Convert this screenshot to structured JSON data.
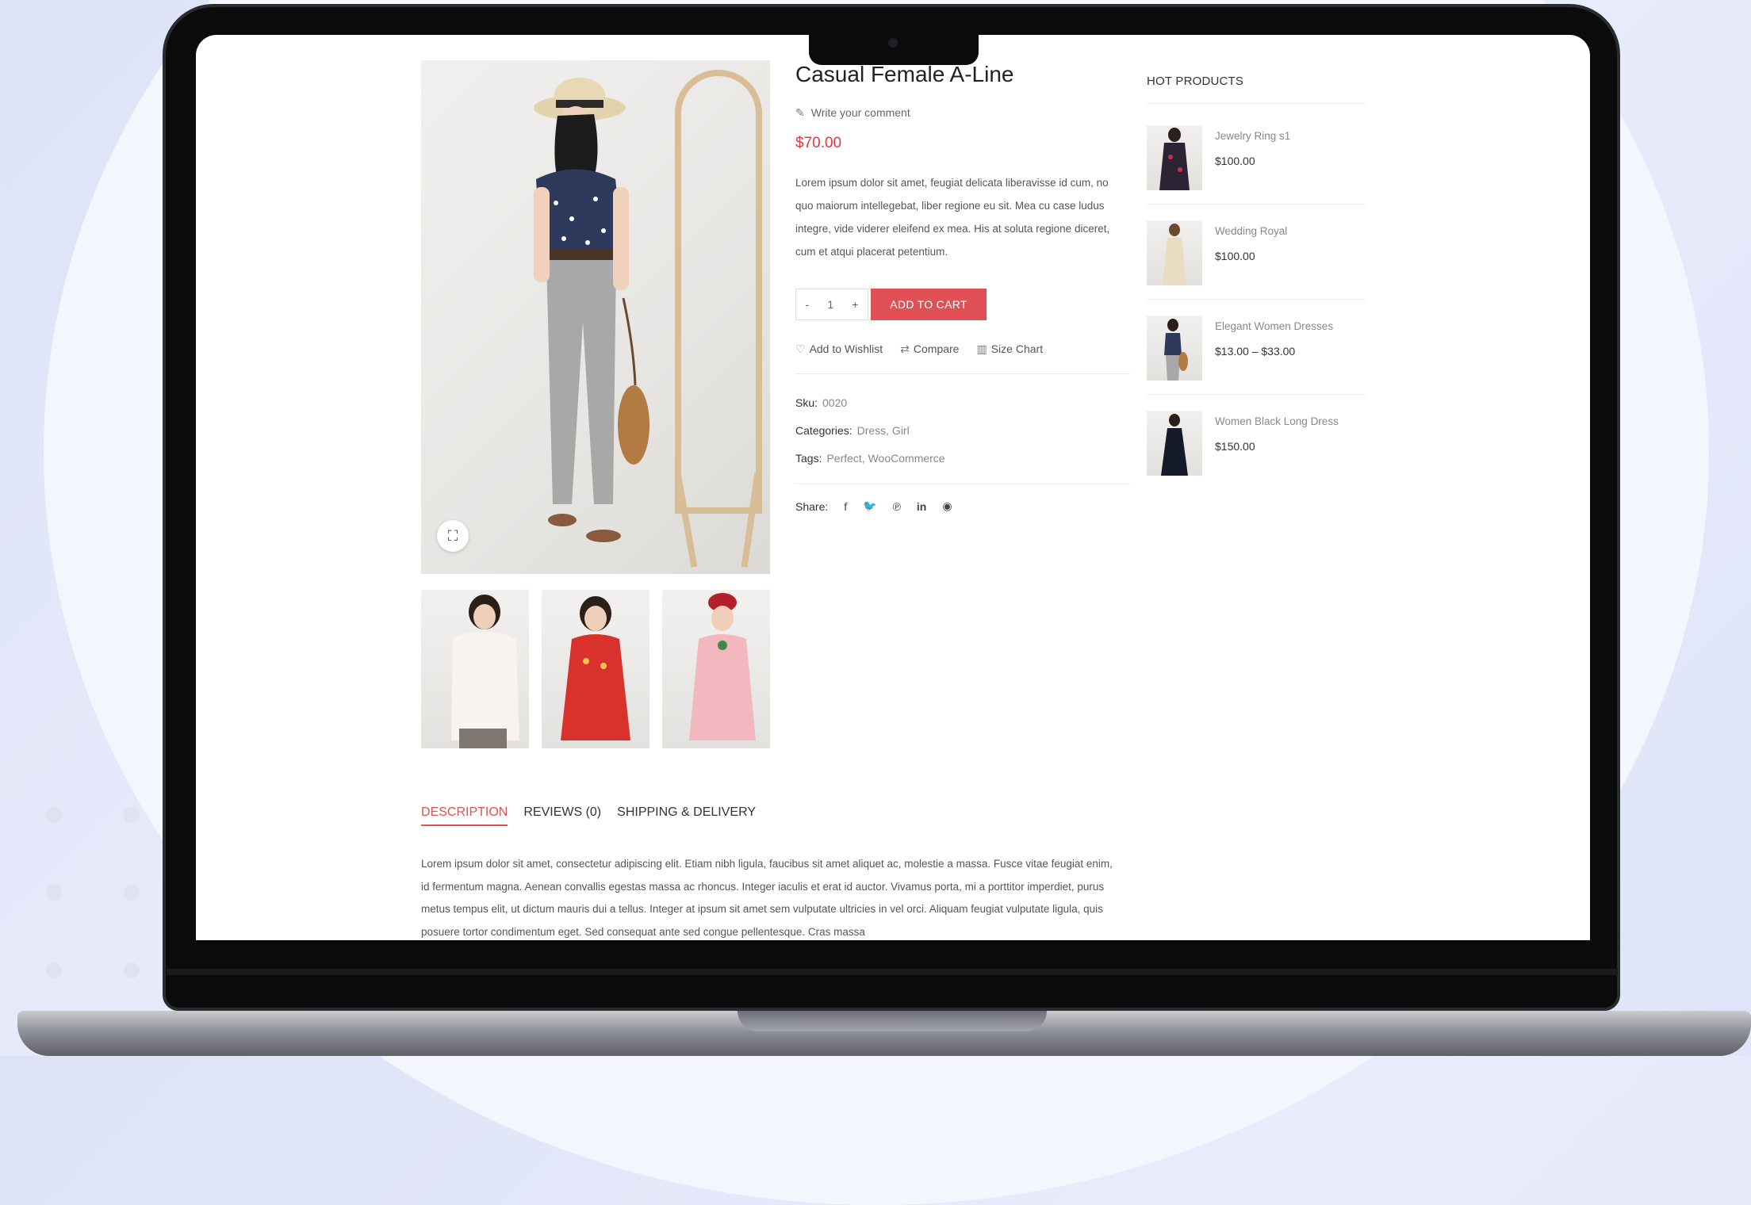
{
  "product": {
    "title": "Casual Female A-Line",
    "comment_link": "Write your comment",
    "price": "$70.00",
    "description": "Lorem ipsum dolor sit amet, feugiat delicata liberavisse id cum, no quo maiorum intellegebat, liber regione eu sit. Mea cu case ludus integre, vide viderer eleifend ex mea. His at soluta regione diceret, cum et atqui placerat petentium.",
    "quantity": "1",
    "qty_minus": "-",
    "qty_plus": "+",
    "add_to_cart": "ADD TO CART",
    "wishlist": "Add to Wishlist",
    "compare": "Compare",
    "size_chart": "Size Chart",
    "sku_label": "Sku:",
    "sku_value": "0020",
    "categories_label": "Categories:",
    "categories_value": "Dress, Girl",
    "tags_label": "Tags:",
    "tags_value": "Perfect, WooCommerce",
    "share_label": "Share:",
    "share_icons": [
      "facebook-icon",
      "twitter-icon",
      "pinterest-icon",
      "linkedin-icon",
      "reddit-icon"
    ]
  },
  "hot_products": {
    "title": "HOT PRODUCTS",
    "items": [
      {
        "name": "Jewelry Ring s1",
        "price": "$100.00"
      },
      {
        "name": "Wedding Royal",
        "price": "$100.00"
      },
      {
        "name": "Elegant Women Dresses",
        "price": "$13.00 – $33.00"
      },
      {
        "name": "Women Black Long Dress",
        "price": "$150.00"
      }
    ]
  },
  "tabs": [
    {
      "label": "DESCRIPTION",
      "active": true
    },
    {
      "label": "REVIEWS (0)",
      "active": false
    },
    {
      "label": "SHIPPING & DELIVERY",
      "active": false
    }
  ],
  "tab_content": "Lorem ipsum dolor sit amet, consectetur adipiscing elit. Etiam nibh ligula, faucibus sit amet aliquet ac, molestie a massa. Fusce vitae feugiat enim, id fermentum magna. Aenean convallis egestas massa ac rhoncus. Integer iaculis et erat id auctor. Vivamus porta, mi a porttitor imperdiet, purus metus tempus elit, ut dictum mauris dui a tellus. Integer at ipsum sit amet sem vulputate ultricies in vel orci. Aliquam feugiat vulputate ligula, quis posuere tortor condimentum eget. Sed consequat ante sed congue pellentesque. Cras massa",
  "colors": {
    "accent": "#e05055",
    "price": "#e1373f",
    "background": "#e4e8fa"
  }
}
